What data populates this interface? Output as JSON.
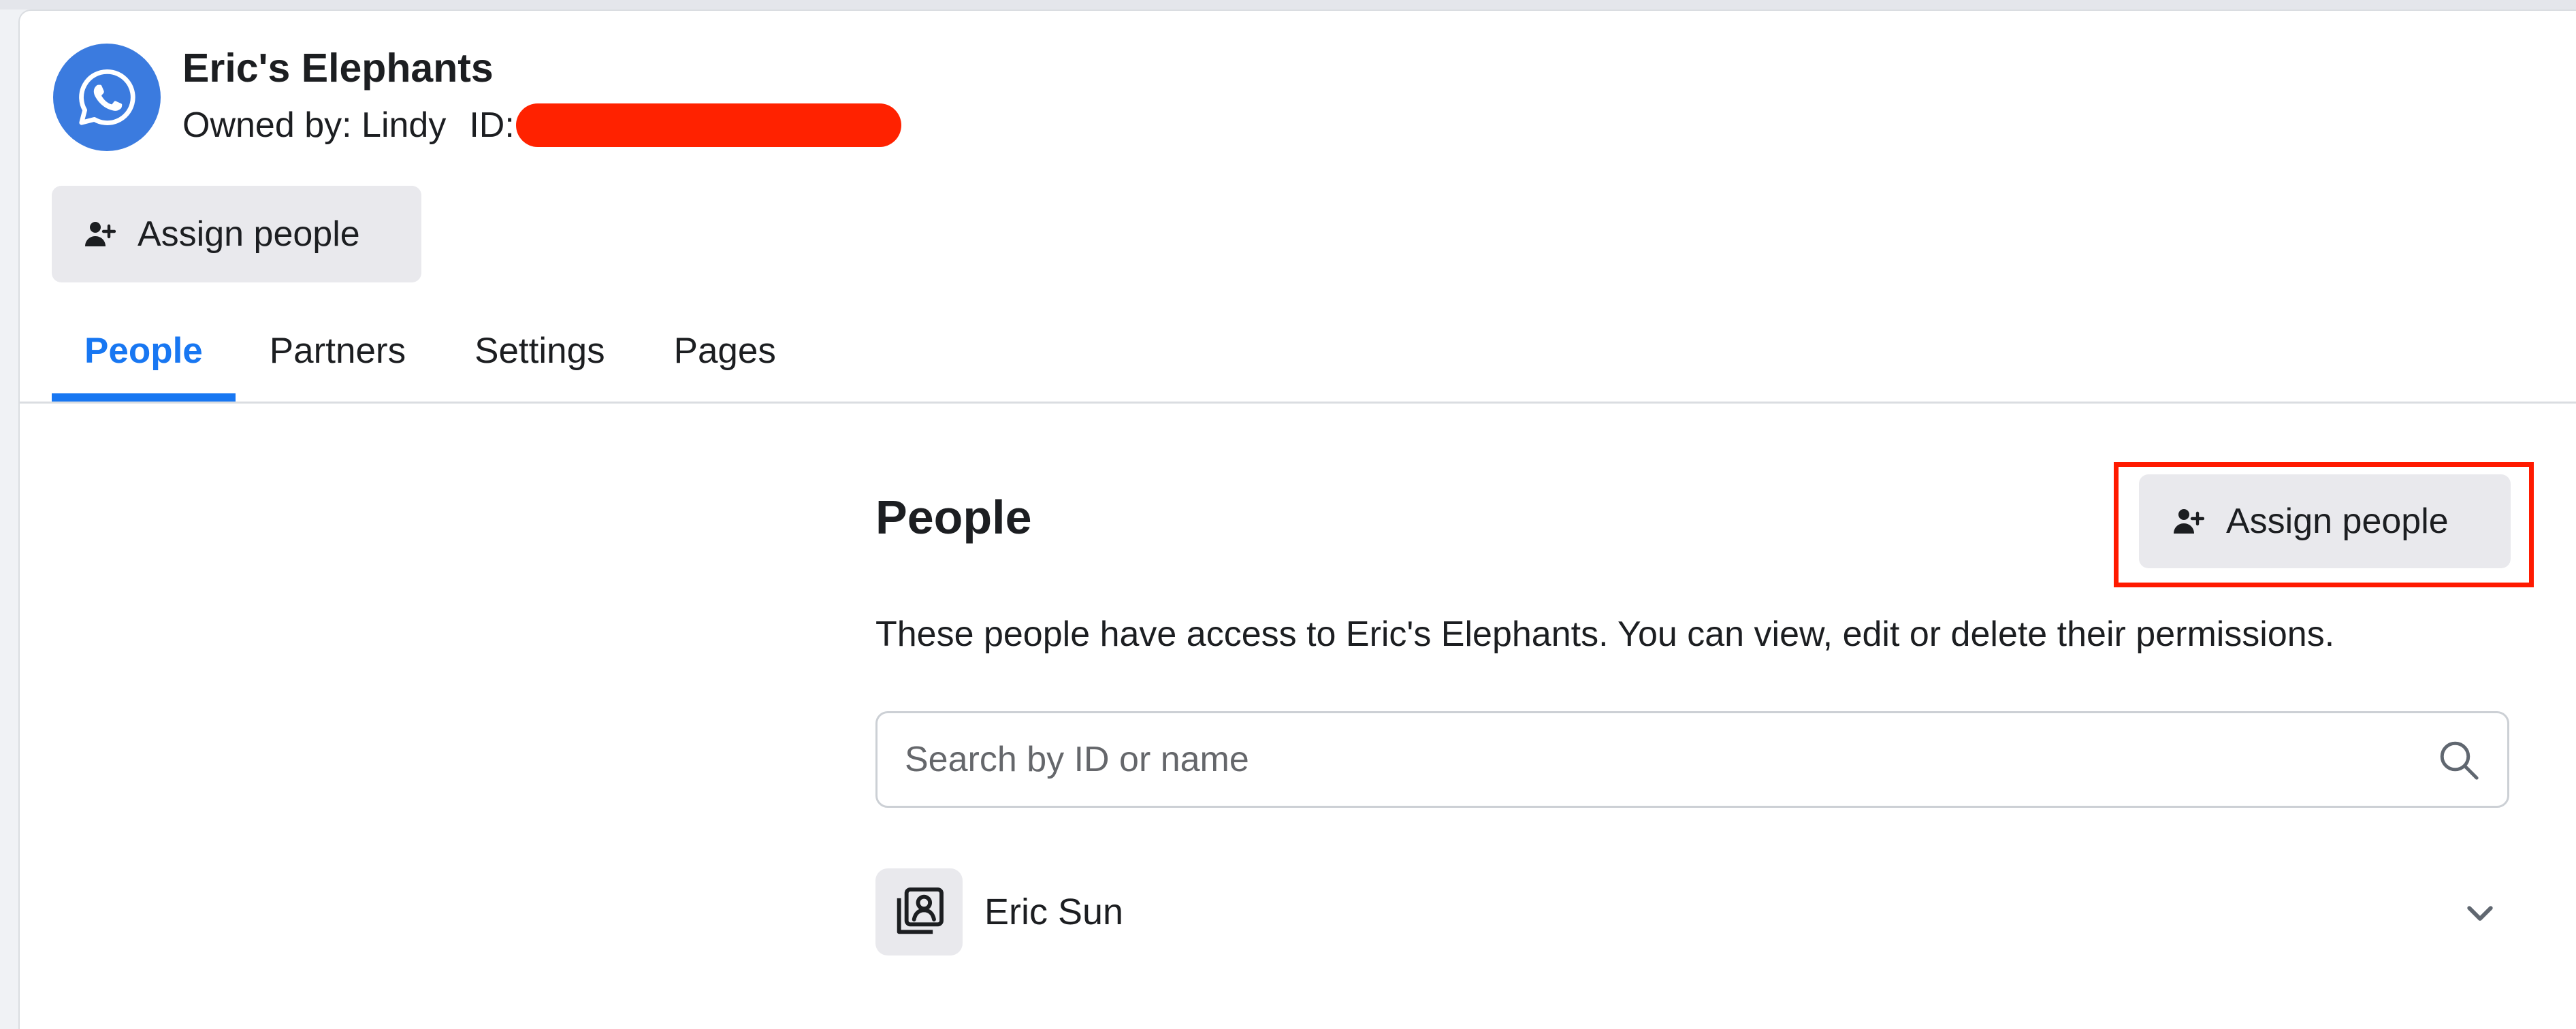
{
  "header": {
    "account_name": "Eric's Elephants",
    "owner_text": "Owned by: Lindy",
    "id_label": "ID:",
    "id_value_redacted": true,
    "icon": "whatsapp-icon",
    "accent_color": "#3b7bdf"
  },
  "header_actions": {
    "assign_label": "Assign people",
    "icon": "add-person-icon"
  },
  "tabs": [
    {
      "label": "People",
      "active": true
    },
    {
      "label": "Partners",
      "active": false
    },
    {
      "label": "Settings",
      "active": false
    },
    {
      "label": "Pages",
      "active": false
    }
  ],
  "people_section": {
    "title": "People",
    "assign_label": "Assign people",
    "highlighted": true,
    "highlight_color": "#ff1a00",
    "description": "These people have access to Eric's Elephants. You can view, edit or delete their permissions.",
    "search": {
      "placeholder": "Search by ID or name",
      "value": "",
      "icon": "search-icon"
    },
    "people": [
      {
        "name": "Eric Sun",
        "icon": "person-card-icon",
        "expand_icon": "chevron-down-icon"
      }
    ]
  },
  "colors": {
    "active_tab": "#1877f2",
    "button_bg": "#e9e9ed",
    "redaction": "#ff2200"
  }
}
